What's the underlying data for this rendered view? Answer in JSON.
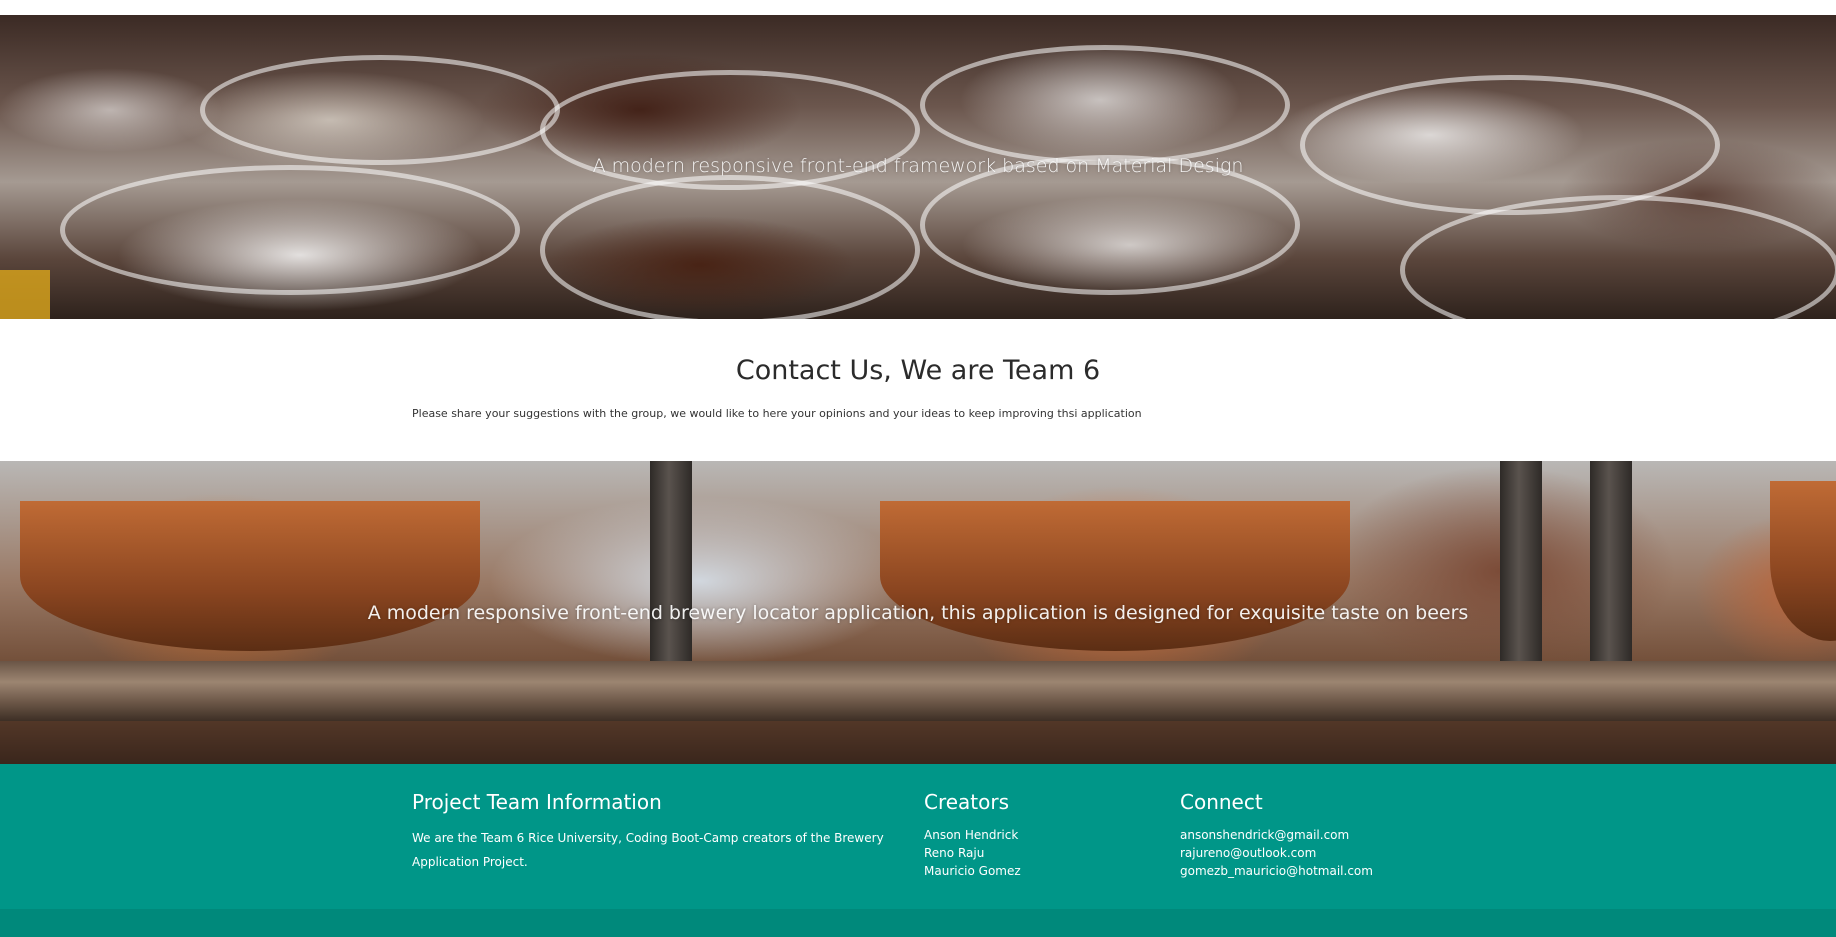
{
  "parallax_top": {
    "caption": "A modern responsive front-end framework based on Material Design"
  },
  "contact": {
    "title": "Contact Us, We are Team 6",
    "text": "Please share your suggestions with the group, we would like to here your opinions and your ideas to keep improving thsi application"
  },
  "parallax_bottom": {
    "caption": "A modern responsive front-end brewery locator application, this application is designed for exquisite taste on beers"
  },
  "footer": {
    "info_title": "Project Team Information",
    "info_text": "We are the Team 6 Rice University, Coding Boot-Camp creators of the Brewery Application Project.",
    "creators_title": "Creators",
    "creators": [
      "Anson Hendrick",
      "Reno Raju",
      "Mauricio Gomez"
    ],
    "connect_title": "Connect",
    "emails": [
      "ansonshendrick@gmail.com",
      "rajureno@outlook.com",
      "gomezb_mauricio@hotmail.com"
    ]
  },
  "colors": {
    "footer": "#009688",
    "footer_copyright": "#00897b"
  }
}
